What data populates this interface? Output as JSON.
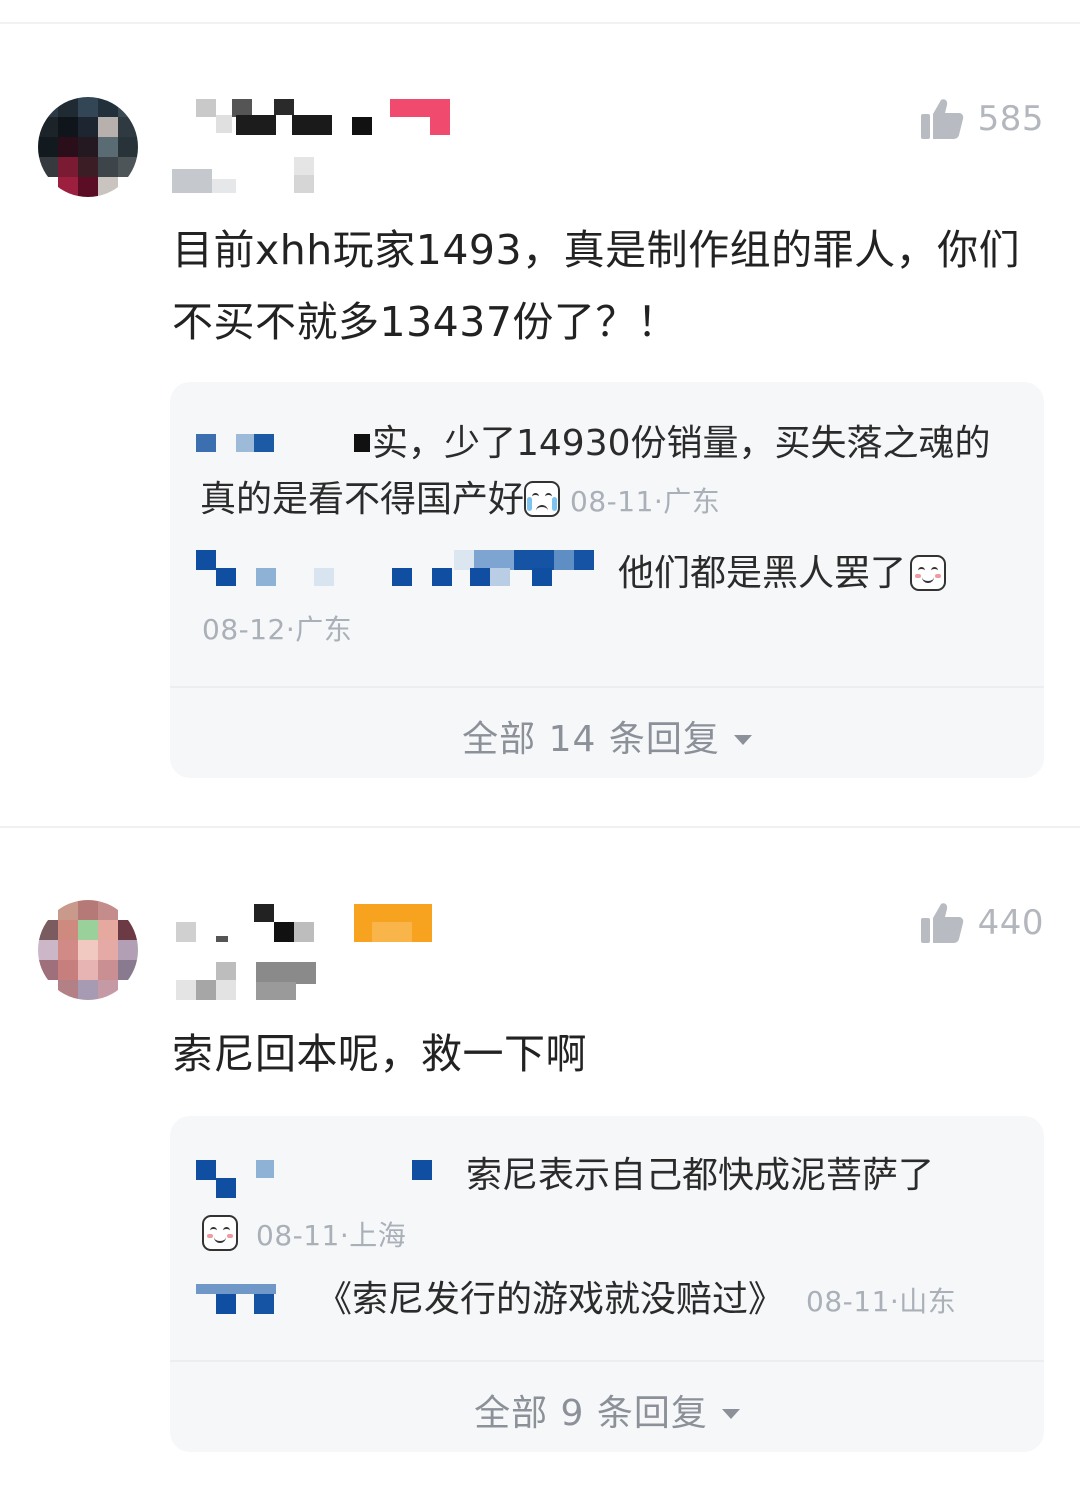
{
  "comments": [
    {
      "likes": "585",
      "text": "目前xhh玩家1493，真是制作组的罪人，你们不买不就多13437份了？！",
      "replies": [
        {
          "text": "实，少了14930份销量，买失落之魂的真的是看不得国产好",
          "emoji": "crying-laugh-emoji",
          "date": "08-11",
          "location": "广东"
        },
        {
          "text": "他们都是黑人罢了",
          "emoji": "smirk-emoji",
          "date": "08-12",
          "location": "广东"
        }
      ],
      "all_replies_label": "全部 14 条回复"
    },
    {
      "likes": "440",
      "text": "索尼回本呢，救一下啊",
      "replies": [
        {
          "text": "索尼表示自己都快成泥菩萨了",
          "emoji": "smirk-emoji",
          "date": "08-11",
          "location": "上海"
        },
        {
          "text": "《索尼发行的游戏就没赔过》",
          "date": "08-11",
          "location": "山东"
        }
      ],
      "all_replies_label": "全部 9 条回复"
    }
  ],
  "icons": {
    "like": "thumbs-up-icon",
    "expand": "caret-down-icon"
  },
  "colors": {
    "meta": "#aab0b8",
    "reply_bg": "#f6f7f9",
    "like": "#b3b7bd"
  }
}
